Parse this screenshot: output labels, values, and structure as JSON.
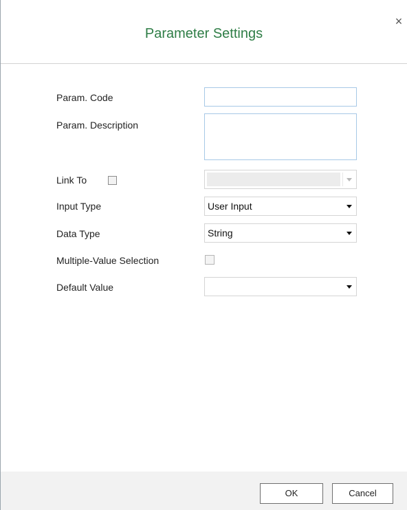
{
  "dialog": {
    "title": "Parameter Settings",
    "close_glyph": "×",
    "close_icon": "close-icon"
  },
  "form": {
    "param_code": {
      "label": "Param. Code",
      "value": ""
    },
    "param_description": {
      "label": "Param. Description",
      "value": ""
    },
    "link_to": {
      "label": "Link To",
      "checked": false,
      "value": "",
      "disabled": true
    },
    "input_type": {
      "label": "Input Type",
      "value": "User Input"
    },
    "data_type": {
      "label": "Data Type",
      "value": "String"
    },
    "multiple_value_selection": {
      "label": "Multiple-Value Selection",
      "checked": false
    },
    "default_value": {
      "label": "Default Value",
      "value": ""
    }
  },
  "footer": {
    "ok_label": "OK",
    "cancel_label": "Cancel"
  },
  "colors": {
    "title": "#2e7d46",
    "input_border_focus": "#a6c8e6",
    "footer_bg": "#f2f2f2"
  }
}
